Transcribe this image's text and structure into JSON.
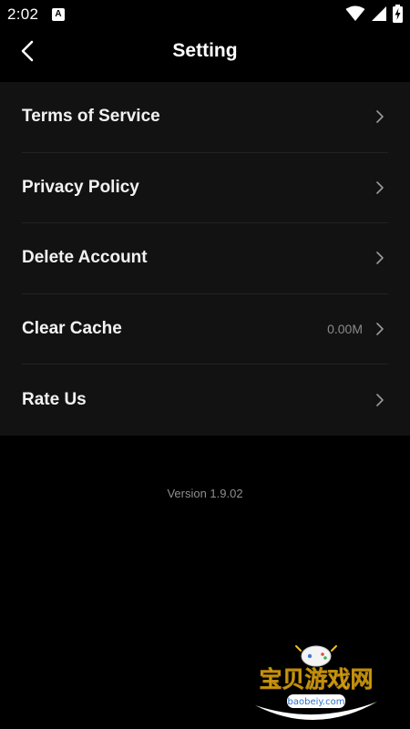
{
  "status_bar": {
    "time": "2:02",
    "notification_icon": "A"
  },
  "header": {
    "title": "Setting"
  },
  "settings": [
    {
      "label": "Terms of Service",
      "value": ""
    },
    {
      "label": "Privacy Policy",
      "value": ""
    },
    {
      "label": "Delete Account",
      "value": ""
    },
    {
      "label": "Clear Cache",
      "value": "0.00M"
    },
    {
      "label": "Rate Us",
      "value": ""
    }
  ],
  "footer": {
    "version": "Version 1.9.02"
  },
  "watermark": {
    "brand": "宝贝游戏网",
    "url": "baobeiy.com"
  },
  "colors": {
    "background": "#000000",
    "list_background": "#121212",
    "divider": "#222222",
    "primary_text": "#ffffff",
    "secondary_text": "#8a8a8a"
  }
}
